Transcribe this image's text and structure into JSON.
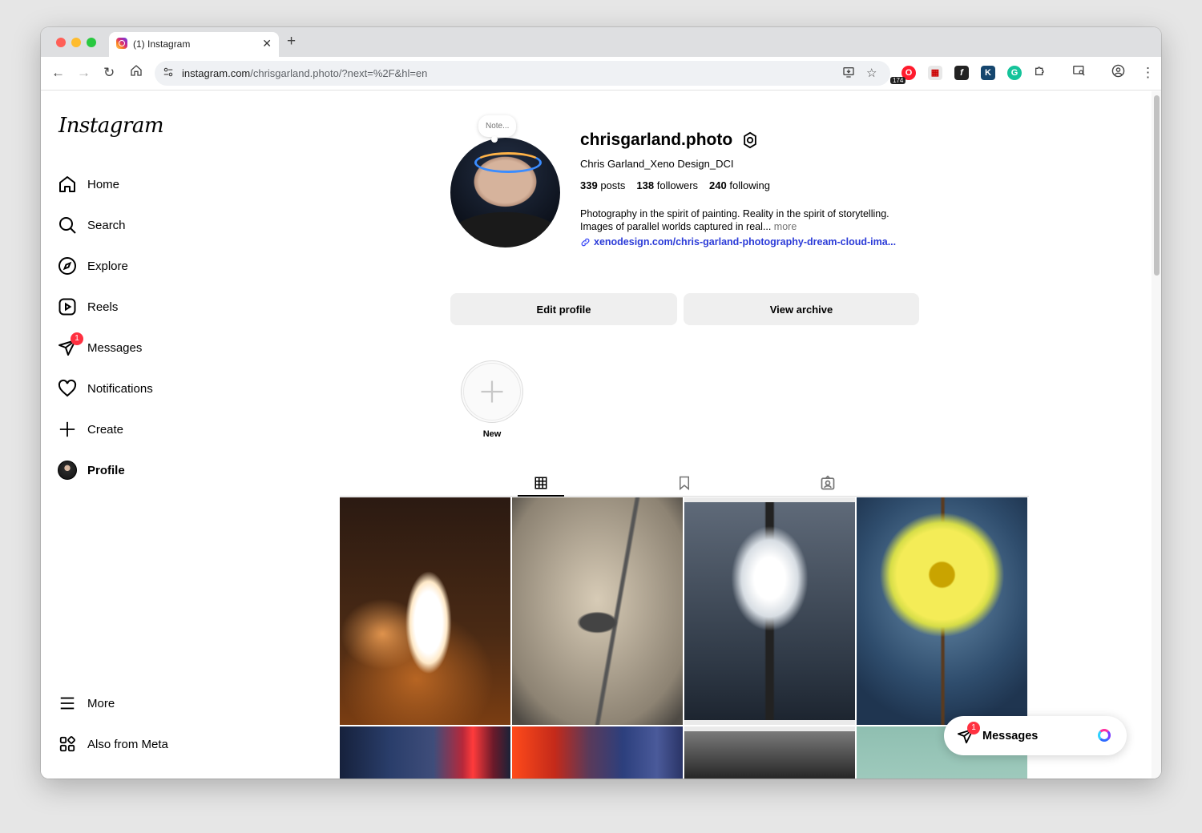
{
  "browser": {
    "tab": {
      "title": "(1) Instagram"
    },
    "new_tab_icon": "plus-icon",
    "url_host": "instagram.com",
    "url_path": "/chrisgarland.photo/?next=%2F&hl=en",
    "extension_badge": "174"
  },
  "sidebar": {
    "logo": "Instagram",
    "items": [
      {
        "label": "Home",
        "icon": "home-icon"
      },
      {
        "label": "Search",
        "icon": "search-icon"
      },
      {
        "label": "Explore",
        "icon": "compass-icon"
      },
      {
        "label": "Reels",
        "icon": "reels-icon"
      },
      {
        "label": "Messages",
        "icon": "messenger-icon",
        "badge": "1"
      },
      {
        "label": "Notifications",
        "icon": "heart-icon"
      },
      {
        "label": "Create",
        "icon": "plus-icon"
      },
      {
        "label": "Profile",
        "icon": "avatar"
      }
    ],
    "bottom_items": [
      {
        "label": "More",
        "icon": "menu-icon"
      },
      {
        "label": "Also from Meta",
        "icon": "meta-apps-icon"
      }
    ]
  },
  "profile": {
    "note_placeholder": "Note...",
    "username": "chrisgarland.photo",
    "full_name": "Chris Garland_Xeno Design_DCI",
    "stats": {
      "posts_count": "339",
      "posts_label": "posts",
      "followers_count": "138",
      "followers_label": "followers",
      "following_count": "240",
      "following_label": "following"
    },
    "bio_line1": "Photography in the spirit of painting. Reality in the spirit of storytelling.",
    "bio_line2": "Images of parallel worlds captured in real...",
    "bio_more": "more",
    "link": "xenodesign.com/chris-garland-photography-dream-cloud-ima...",
    "edit_button": "Edit profile",
    "archive_button": "View archive",
    "new_story_label": "New"
  },
  "profile_tabs": [
    {
      "icon": "grid-icon",
      "active": true
    },
    {
      "icon": "bookmark-icon",
      "active": false
    },
    {
      "icon": "tagged-icon",
      "active": false
    }
  ],
  "floating_messages": {
    "label": "Messages",
    "badge": "1"
  },
  "colors": {
    "badge_red": "#ff3040",
    "link_blue": "#00376b",
    "button_gray": "#efefef"
  }
}
